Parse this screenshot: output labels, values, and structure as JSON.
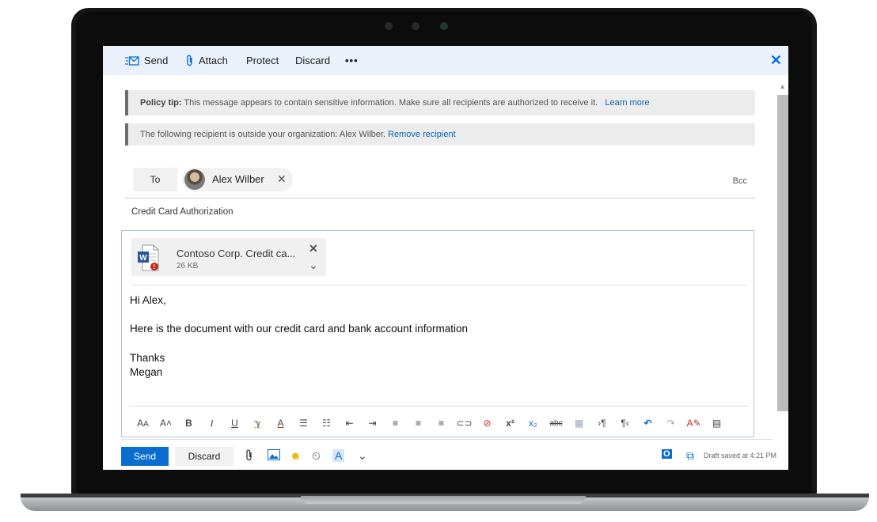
{
  "toolbar": {
    "send_label": "Send",
    "attach_label": "Attach",
    "protect_label": "Protect",
    "discard_label": "Discard",
    "more_label": "•••",
    "close_label": "✕"
  },
  "policy_tip": {
    "prefix": "Policy tip:",
    "message": " This message appears to contain sensitive information. Make sure all recipients are authorized to receive it.",
    "link": "Learn more"
  },
  "recipient_tip": {
    "message": "The following recipient is outside your organization: Alex Wilber.",
    "link": "Remove recipient"
  },
  "to_field": {
    "label": "To",
    "recipient_name": "Alex Wilber",
    "remove_label": "✕",
    "bcc_label": "Bcc"
  },
  "subject": "Credit Card Authorization",
  "attachment": {
    "name": "Contoso Corp. Credit ca...",
    "size": "26 KB",
    "icon": "word-document-icon"
  },
  "message_lines": [
    "Hi Alex,",
    "Here is the document with our credit card and bank account information",
    "Thanks",
    "Megan"
  ],
  "format_toolbar": {
    "icons": [
      "font-size-icon",
      "grow-font-icon",
      "bold-icon",
      "italic-icon",
      "underline-icon",
      "highlight-icon",
      "font-color-icon",
      "bullets-icon",
      "numbering-icon",
      "decrease-indent-icon",
      "increase-indent-icon",
      "align-left-icon",
      "align-center-icon",
      "align-right-icon",
      "insert-link-icon",
      "remove-link-icon",
      "superscript-icon",
      "subscript-icon",
      "strikethrough-icon",
      "insert-picture-icon",
      "ltr-icon",
      "rtl-icon",
      "undo-icon",
      "redo-icon",
      "clear-formatting-icon",
      "insert-table-icon"
    ]
  },
  "footer": {
    "send_label": "Send",
    "discard_label": "Discard",
    "draft_status": "Draft saved at 4:21 PM"
  },
  "colors": {
    "accent": "#0a6ed1",
    "topbar": "#eaf1fb",
    "tip_bg": "#ececec"
  }
}
